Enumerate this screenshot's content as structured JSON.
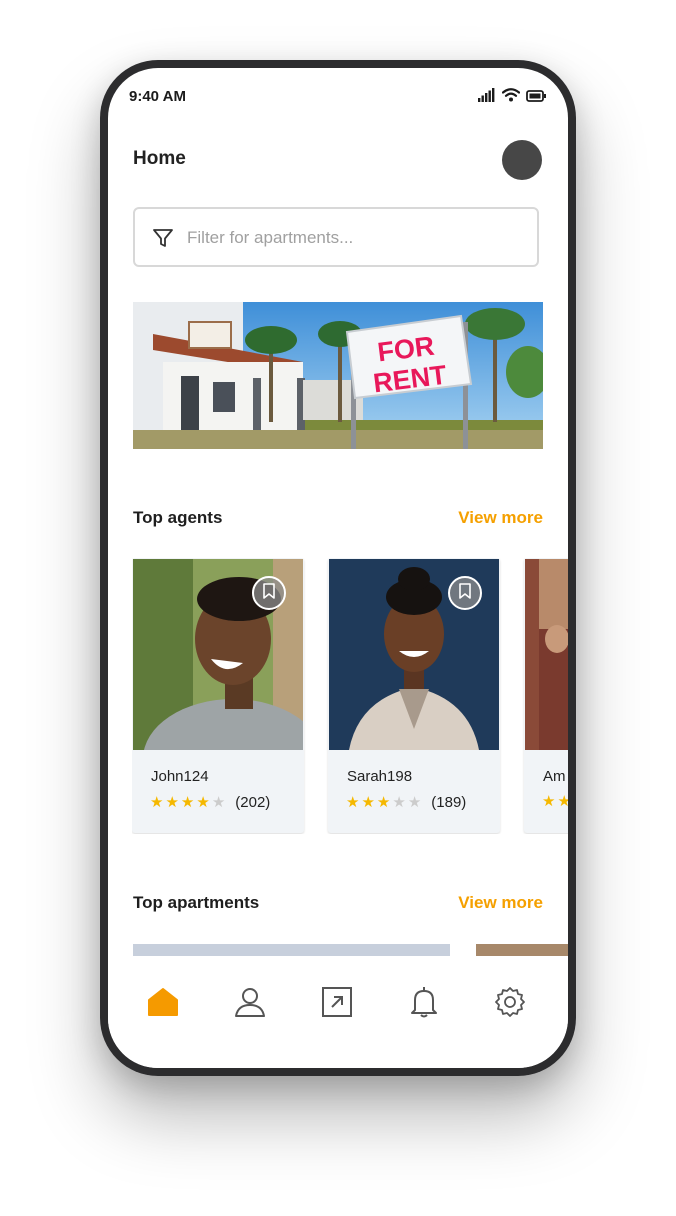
{
  "status": {
    "time": "9:40 AM",
    "icons": [
      "signal-icon",
      "wifi-icon",
      "battery-icon"
    ]
  },
  "header": {
    "title": "Home",
    "avatar": "avatar"
  },
  "search": {
    "placeholder": "Filter for apartments...",
    "value": "",
    "icon": "filter-icon"
  },
  "banner": {
    "sign_line1": "FOR",
    "sign_line2": "RENT"
  },
  "top_agents": {
    "title": "Top agents",
    "view_more": "View more",
    "agents": [
      {
        "name": "John124",
        "stars": 4,
        "max_stars": 5,
        "reviews": "(202)"
      },
      {
        "name": "Sarah198",
        "stars": 3,
        "max_stars": 5,
        "reviews": "(189)"
      },
      {
        "name": "Am",
        "stars": 2,
        "max_stars": 5,
        "reviews": ""
      }
    ]
  },
  "top_apartments": {
    "title": "Top apartments",
    "view_more": "View more"
  },
  "tabbar": {
    "items": [
      {
        "icon": "home-icon",
        "active": true
      },
      {
        "icon": "user-icon",
        "active": false
      },
      {
        "icon": "share-icon",
        "active": false
      },
      {
        "icon": "bell-icon",
        "active": false
      },
      {
        "icon": "gear-icon",
        "active": false
      }
    ]
  },
  "colors": {
    "accent": "#f5a000",
    "star": "#f5b800",
    "star_off": "#cccccc",
    "card_bg": "#f1f4f7",
    "frame": "#2c2c2e"
  }
}
